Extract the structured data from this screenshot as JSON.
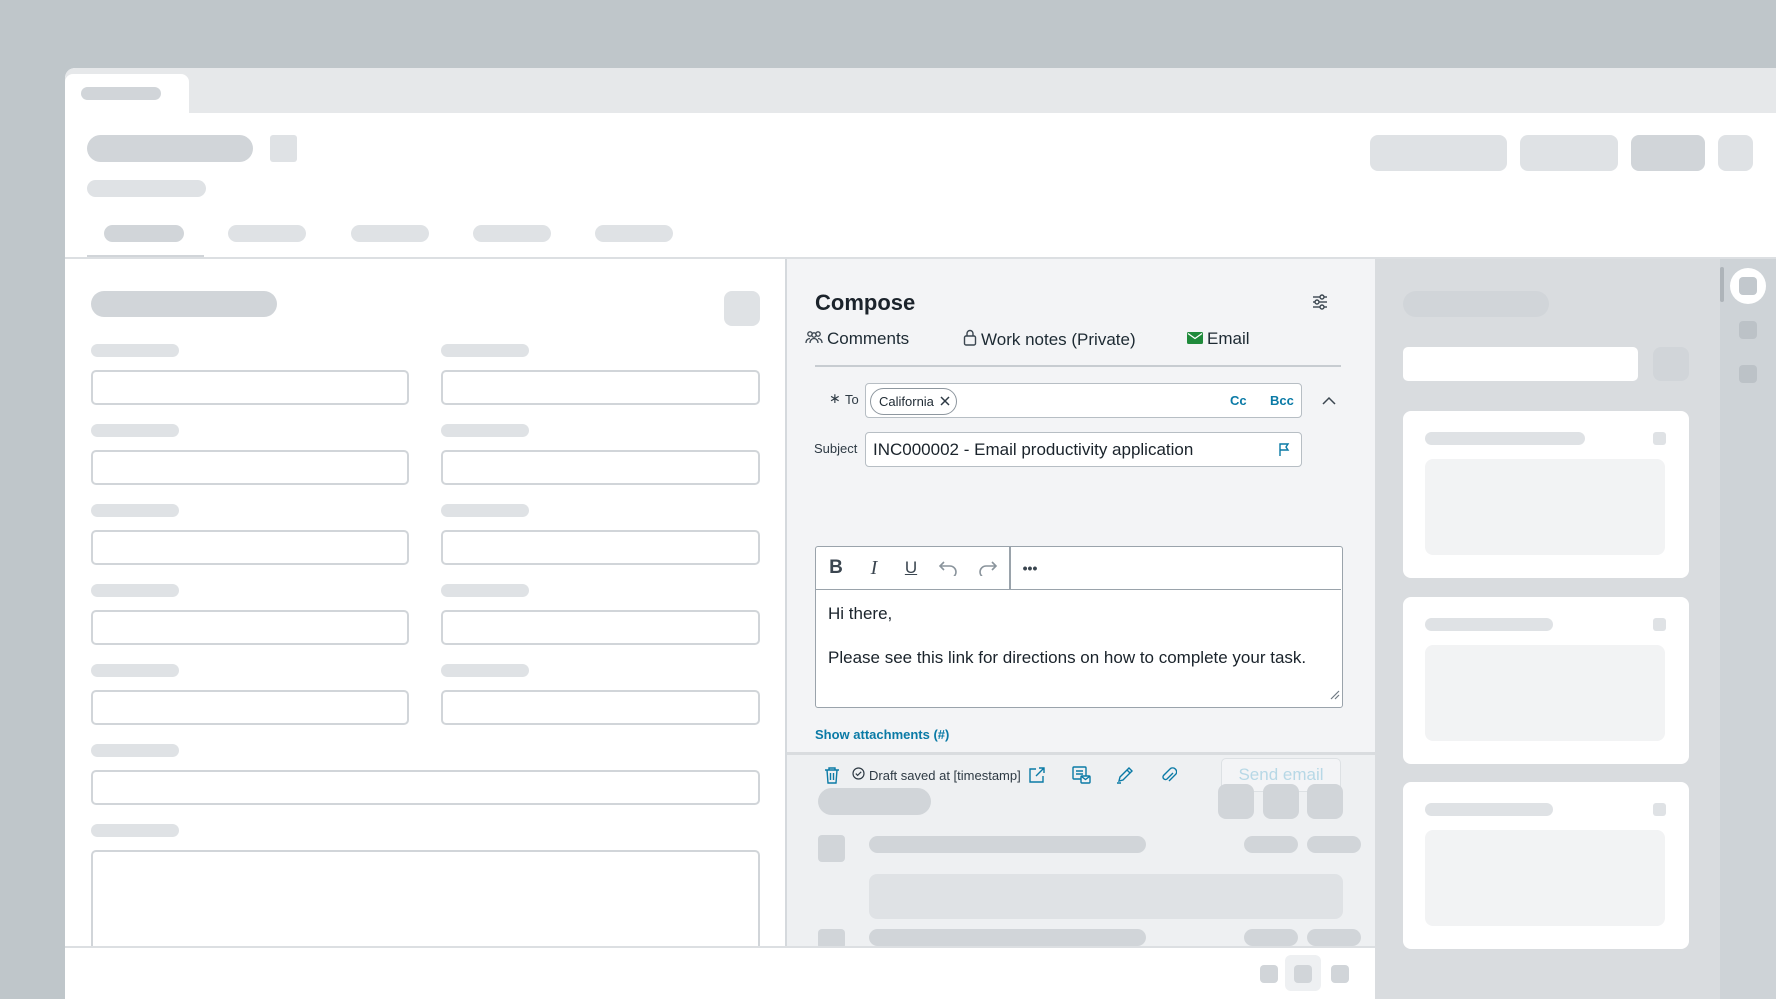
{
  "compose": {
    "title": "Compose",
    "tabs": [
      {
        "label": "Comments",
        "icon": "people-icon"
      },
      {
        "label": "Work notes (Private)",
        "icon": "lock-icon"
      },
      {
        "label": "Email",
        "icon": "envelope-icon"
      }
    ],
    "to": {
      "required_marker": "∗",
      "label": "To",
      "recipients": [
        "California"
      ],
      "cc_label": "Cc",
      "bcc_label": "Bcc"
    },
    "subject": {
      "label": "Subject",
      "value": "INC000002 - Email productivity application"
    },
    "toolbar": {
      "bold": "B",
      "italic": "I",
      "underline": "U",
      "more": "•••"
    },
    "body": {
      "greeting": "Hi there,",
      "message": "Please see this link for directions on how to complete your task."
    },
    "show_attachments": "Show attachments (#)",
    "draft_status": "Draft saved at [timestamp]",
    "send_label": "Send email"
  },
  "colors": {
    "accent": "#0a7aa6",
    "email_icon": "#1f8a3b",
    "send_disabled_text": "#b7d8e6"
  }
}
